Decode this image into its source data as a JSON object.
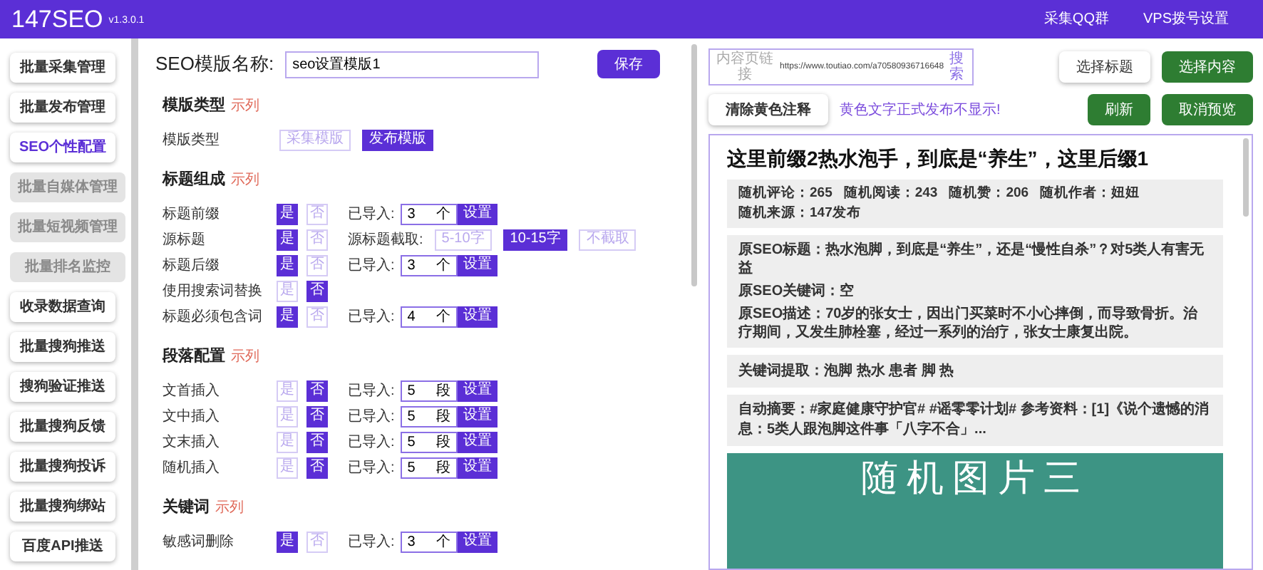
{
  "header": {
    "logo": "147SEO",
    "version": "v1.3.0.1",
    "links": [
      "采集QQ群",
      "VPS拨号设置"
    ]
  },
  "sidebar": {
    "items": [
      {
        "label": "批量采集管理",
        "selected": false,
        "disabled": false
      },
      {
        "label": "批量发布管理",
        "selected": false,
        "disabled": false
      },
      {
        "label": "SEO个性配置",
        "selected": true,
        "disabled": false
      },
      {
        "label": "批量自媒体管理",
        "selected": false,
        "disabled": true
      },
      {
        "label": "批量短视频管理",
        "selected": false,
        "disabled": true
      },
      {
        "label": "批量排名监控",
        "selected": false,
        "disabled": true
      },
      {
        "label": "收录数据查询",
        "selected": false,
        "disabled": false
      },
      {
        "label": "批量搜狗推送",
        "selected": false,
        "disabled": false
      },
      {
        "label": "搜狗验证推送",
        "selected": false,
        "disabled": false
      },
      {
        "label": "批量搜狗反馈",
        "selected": false,
        "disabled": false
      },
      {
        "label": "批量搜狗投诉",
        "selected": false,
        "disabled": false
      },
      {
        "label": "批量搜狗绑站",
        "selected": false,
        "disabled": false
      },
      {
        "label": "百度API推送",
        "selected": false,
        "disabled": false
      }
    ]
  },
  "editor": {
    "name_label": "SEO模版名称:",
    "name_value": "seo设置模版1",
    "save": "保存",
    "sections": [
      {
        "title": "模版类型",
        "example": "示列",
        "rows": [
          {
            "kind": "choice",
            "label": "模版类型",
            "options": [
              {
                "label": "采集模版",
                "selected": false
              },
              {
                "label": "发布模版",
                "selected": true
              }
            ]
          }
        ]
      },
      {
        "title": "标题组成",
        "example": "示列",
        "rows": [
          {
            "kind": "toggle",
            "label": "标题前缀",
            "options": [
              {
                "label": "是",
                "selected": true
              },
              {
                "label": "否",
                "selected": false
              }
            ],
            "extra": {
              "kind": "import",
              "label": "已导入:",
              "value": "3",
              "unit": "个",
              "button": "设置"
            }
          },
          {
            "kind": "toggle",
            "label": "源标题",
            "options": [
              {
                "label": "是",
                "selected": true
              },
              {
                "label": "否",
                "selected": false
              }
            ],
            "extra": {
              "kind": "cut",
              "label": "源标题截取:",
              "options": [
                {
                  "label": "5-10字",
                  "selected": false
                },
                {
                  "label": "10-15字",
                  "selected": true
                },
                {
                  "label": "不截取",
                  "selected": false
                }
              ]
            }
          },
          {
            "kind": "toggle",
            "label": "标题后缀",
            "options": [
              {
                "label": "是",
                "selected": true
              },
              {
                "label": "否",
                "selected": false
              }
            ],
            "extra": {
              "kind": "import",
              "label": "已导入:",
              "value": "3",
              "unit": "个",
              "button": "设置"
            }
          },
          {
            "kind": "toggle",
            "label": "使用搜索词替换",
            "options": [
              {
                "label": "是",
                "selected": false
              },
              {
                "label": "否",
                "selected": true
              }
            ]
          },
          {
            "kind": "toggle",
            "label": "标题必须包含词",
            "options": [
              {
                "label": "是",
                "selected": true
              },
              {
                "label": "否",
                "selected": false
              }
            ],
            "extra": {
              "kind": "import",
              "label": "已导入:",
              "value": "4",
              "unit": "个",
              "button": "设置"
            }
          }
        ]
      },
      {
        "title": "段落配置",
        "example": "示列",
        "rows": [
          {
            "kind": "toggle",
            "label": "文首插入",
            "options": [
              {
                "label": "是",
                "selected": false
              },
              {
                "label": "否",
                "selected": true
              }
            ],
            "extra": {
              "kind": "import",
              "label": "已导入:",
              "value": "5",
              "unit": "段",
              "button": "设置"
            }
          },
          {
            "kind": "toggle",
            "label": "文中插入",
            "options": [
              {
                "label": "是",
                "selected": false
              },
              {
                "label": "否",
                "selected": true
              }
            ],
            "extra": {
              "kind": "import",
              "label": "已导入:",
              "value": "5",
              "unit": "段",
              "button": "设置"
            }
          },
          {
            "kind": "toggle",
            "label": "文末插入",
            "options": [
              {
                "label": "是",
                "selected": false
              },
              {
                "label": "否",
                "selected": true
              }
            ],
            "extra": {
              "kind": "import",
              "label": "已导入:",
              "value": "5",
              "unit": "段",
              "button": "设置"
            }
          },
          {
            "kind": "toggle",
            "label": "随机插入",
            "options": [
              {
                "label": "是",
                "selected": false
              },
              {
                "label": "否",
                "selected": true
              }
            ],
            "extra": {
              "kind": "import",
              "label": "已导入:",
              "value": "5",
              "unit": "段",
              "button": "设置"
            }
          }
        ]
      },
      {
        "title": "关键词",
        "example": "示列",
        "rows": [
          {
            "kind": "toggle",
            "label": "敏感词删除",
            "options": [
              {
                "label": "是",
                "selected": true
              },
              {
                "label": "否",
                "selected": false
              }
            ],
            "extra": {
              "kind": "import",
              "label": "已导入:",
              "value": "3",
              "unit": "个",
              "button": "设置"
            }
          }
        ]
      }
    ]
  },
  "preview": {
    "url_label": "内容页链接",
    "url_value": "https://www.toutiao.com/a70580936716648",
    "search": "搜索",
    "buttons_top": [
      {
        "label": "选择标题",
        "kind": "plain"
      },
      {
        "label": "选择内容",
        "kind": "primary"
      }
    ],
    "clear": "清除黄色注释",
    "notice": "黄色文字正式发布不显示!",
    "buttons_second": [
      {
        "label": "刷新",
        "kind": "primary"
      },
      {
        "label": "取消预览",
        "kind": "primary"
      }
    ],
    "title": "这里前缀2热水泡手，到底是“养生”，这里后缀1",
    "stats": [
      "随机评论：265",
      "随机阅读：243",
      "随机赞：206",
      "随机作者：妞妞",
      "随机来源：147发布"
    ],
    "info": [
      "原SEO标题：热水泡脚，到底是“养生”，还是“慢性自杀”？对5类人有害无益",
      "原SEO关键词：空",
      "原SEO描述：70岁的张女士，因出门买菜时不小心摔倒，而导致骨折。治疗期间，又发生肺栓塞，经过一系列的治疗，张女士康复出院。"
    ],
    "keywords": "关键词提取：泡脚 热水 患者 脚 热",
    "summary": "自动摘要：#家庭健康守护官# #谣零零计划# 参考资料：[1]《说个遗憾的消息：5类人跟泡脚这件事「八字不合」...",
    "image_text": "随机图片三"
  }
}
